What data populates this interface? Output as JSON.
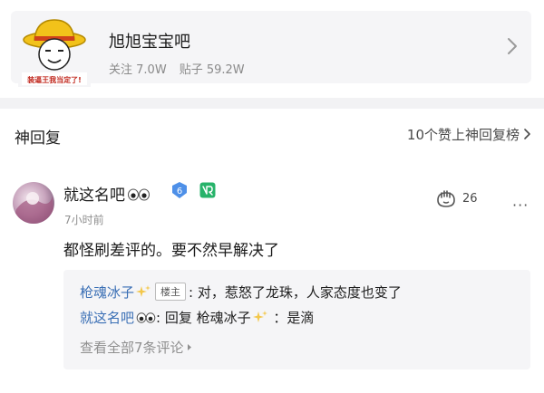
{
  "forum": {
    "name": "旭旭宝宝吧",
    "follow_label": "关注",
    "follow_count": "7.0W",
    "posts_label": "贴子",
    "posts_count": "59.2W",
    "avatar_caption": "装逼王我当定了!"
  },
  "section": {
    "title": "神回复",
    "link": "10个赞上神回复榜"
  },
  "comment": {
    "user": "就这名吧",
    "level": "6",
    "time": "7小时前",
    "likes": "26",
    "more": "···",
    "body": "都怪刷差评的。要不然早解决了"
  },
  "replies": [
    {
      "user": "枪魂冰子",
      "tag": "楼主",
      "separator": ": ",
      "text": "对，惹怒了龙珠，人家态度也变了"
    },
    {
      "user": "就这名吧",
      "prefix": ": 回复 ",
      "target": "枪魂冰子",
      "separator": " ：",
      "text": "是滴"
    }
  ],
  "view_all": "查看全部7条评论",
  "colors": {
    "username_link": "#3a6fb5",
    "level_badge": "#4e90e8",
    "sign_badge": "#27b36a",
    "card_bg": "#f5f5f7"
  }
}
